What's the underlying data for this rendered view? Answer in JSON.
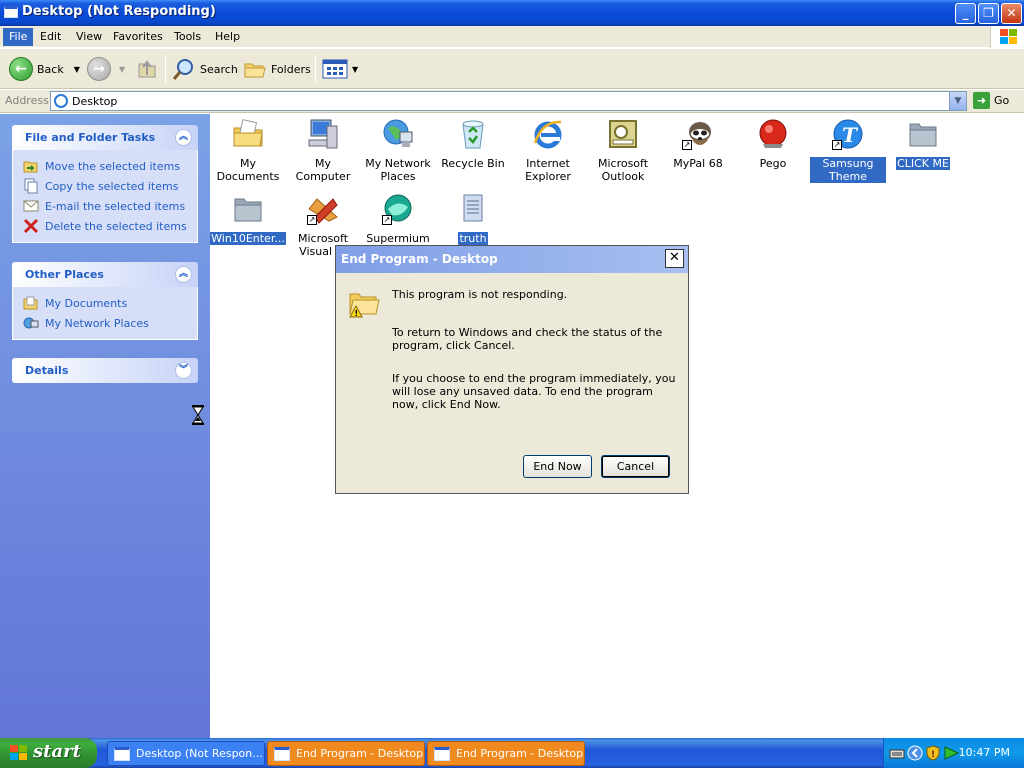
{
  "window": {
    "title": "Desktop (Not Responding)"
  },
  "menu": [
    "File",
    "Edit",
    "View",
    "Favorites",
    "Tools",
    "Help"
  ],
  "toolbar": {
    "back": "Back",
    "search": "Search",
    "folders": "Folders"
  },
  "address": {
    "label": "Address",
    "value": "Desktop",
    "go": "Go"
  },
  "taskpane": {
    "file_folder_tasks": {
      "title": "File and Folder Tasks",
      "items": [
        "Move the selected items",
        "Copy the selected items",
        "E-mail the selected items",
        "Delete the selected items"
      ]
    },
    "other_places": {
      "title": "Other Places",
      "items": [
        "My Documents",
        "My Network Places"
      ]
    },
    "details": {
      "title": "Details"
    }
  },
  "icons": [
    {
      "label": "My Documents"
    },
    {
      "label": "My Computer"
    },
    {
      "label": "My Network Places"
    },
    {
      "label": "Recycle Bin"
    },
    {
      "label": "Internet Explorer"
    },
    {
      "label": "Microsoft Outlook"
    },
    {
      "label": "MyPal 68"
    },
    {
      "label": "Pego"
    },
    {
      "label": "Samsung Theme"
    },
    {
      "label": "CLICK ME"
    },
    {
      "label": "Win10Enter..."
    },
    {
      "label": "Microsoft Visual St"
    },
    {
      "label": "Supermium"
    },
    {
      "label": "truth"
    }
  ],
  "dialog": {
    "title": "End Program - Desktop",
    "line1": "This program is not responding.",
    "line2": "To return to Windows and check the status of the program, click Cancel.",
    "line3": "If you choose to end the program immediately, you will lose any unsaved data. To end the program now, click End Now.",
    "end_now": "End Now",
    "cancel": "Cancel"
  },
  "taskbar": {
    "start": "start",
    "tasks": [
      "Desktop (Not Respon...",
      "End Program - Desktop",
      "End Program - Desktop"
    ],
    "clock": "10:47 PM"
  }
}
